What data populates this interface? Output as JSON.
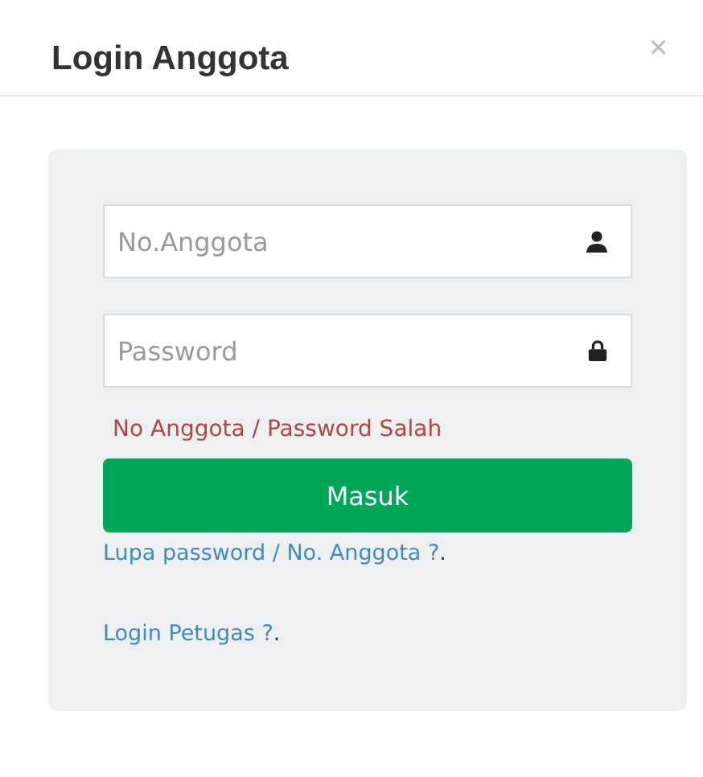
{
  "dialog": {
    "title": "Login Anggota",
    "close": "×"
  },
  "fields": [
    {
      "placeholder": "No.Anggota",
      "kind": "user"
    },
    {
      "placeholder": "Password",
      "kind": "password"
    }
  ],
  "error": "No Anggota / Password Salah",
  "submit": "Masuk",
  "links": [
    {
      "label": "Lupa password / No. Anggota ?",
      "suffix": "."
    },
    {
      "label": "Login Petugas ?",
      "suffix": "."
    }
  ]
}
